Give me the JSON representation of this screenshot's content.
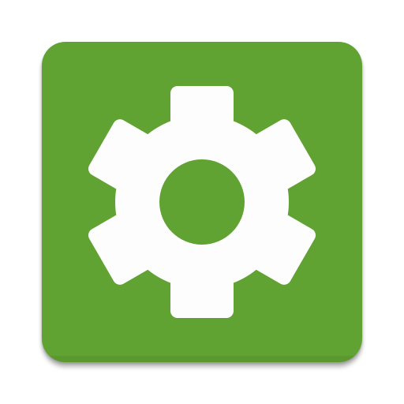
{
  "app_icon": {
    "icon": "gear-icon",
    "background_color": "#61a333",
    "glyph_color": "#fdfdfd"
  }
}
